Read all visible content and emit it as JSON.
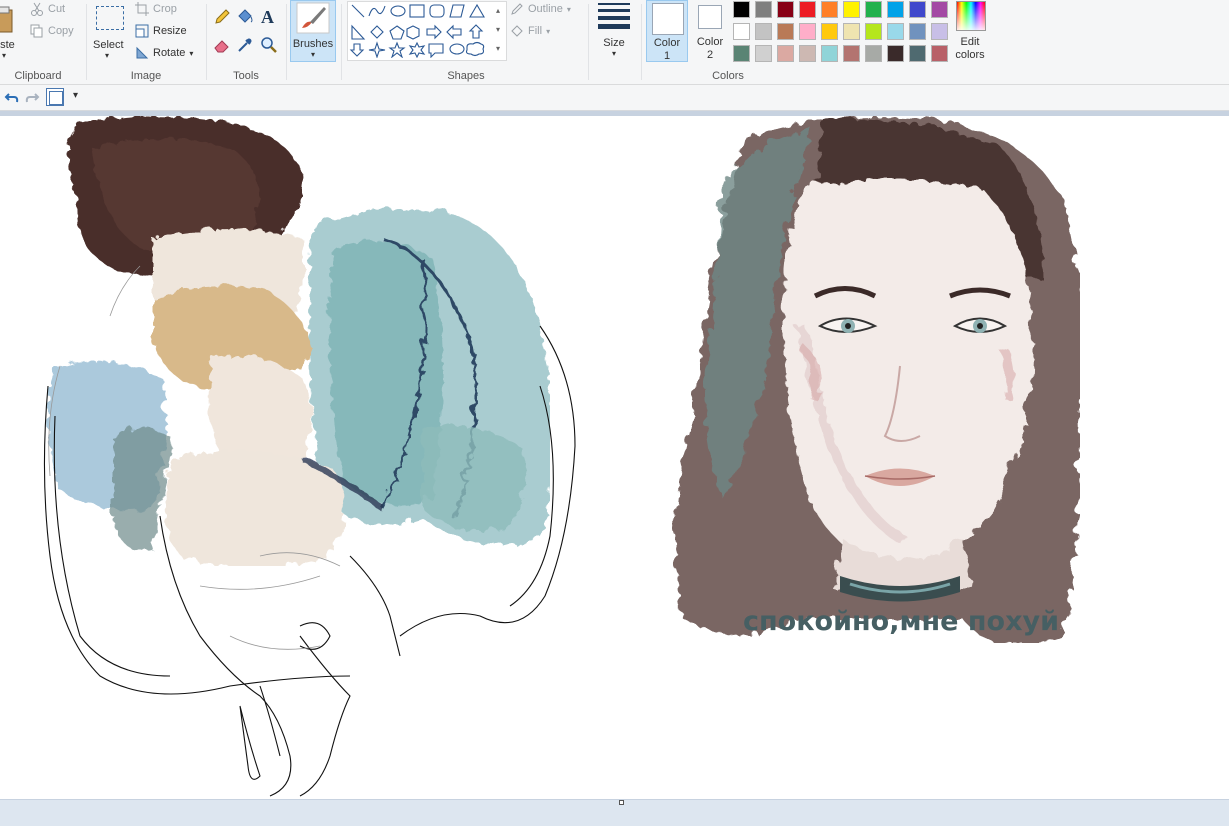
{
  "ribbon": {
    "clipboard": {
      "paste_label": "aste",
      "cut_label": "Cut",
      "copy_label": "Copy",
      "group_label": "Clipboard"
    },
    "image": {
      "select_label": "Select",
      "crop_label": "Crop",
      "resize_label": "Resize",
      "rotate_label": "Rotate",
      "group_label": "Image"
    },
    "tools": {
      "group_label": "Tools",
      "text_tool_glyph": "A"
    },
    "brushes": {
      "label": "Brushes"
    },
    "shapes": {
      "group_label": "Shapes",
      "outline_label": "Outline",
      "fill_label": "Fill"
    },
    "size": {
      "label": "Size"
    },
    "colors": {
      "color1_label": "Color",
      "color1_number": "1",
      "color2_label": "Color",
      "color2_number": "2",
      "edit_label_line1": "Edit",
      "edit_label_line2": "colors",
      "group_label": "Colors",
      "palette": [
        [
          "#000000",
          "#7f7f7f",
          "#880015",
          "#ed1c24",
          "#ff7f27",
          "#fff200",
          "#22b14c",
          "#00a2e8",
          "#3f48cc",
          "#a349a4"
        ],
        [
          "#ffffff",
          "#c3c3c3",
          "#b97a57",
          "#ffaec9",
          "#ffc90e",
          "#efe4b0",
          "#b5e61d",
          "#99d9ea",
          "#7092be",
          "#c8bfe7"
        ],
        [
          "#5a8474",
          "#d0d0d0",
          "#dba9a2",
          "#cdb8b2",
          "#90d4d8",
          "#b37470",
          "#a7aaa6",
          "#3a2a2a",
          "#4f6a70",
          "#b86068"
        ]
      ]
    }
  },
  "canvas": {
    "caption": "спокойно,мне похуй"
  }
}
